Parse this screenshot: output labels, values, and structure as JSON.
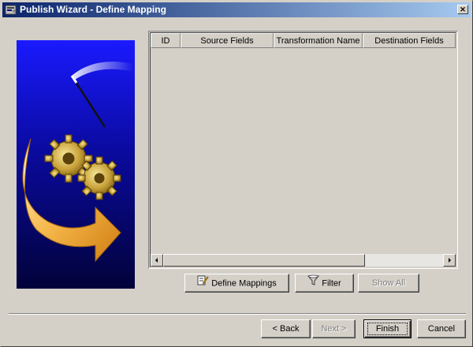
{
  "window": {
    "title": "Publish Wizard - Define Mapping",
    "close_glyph": "✕"
  },
  "table": {
    "columns": [
      "ID",
      "Source Fields",
      "Transformation Name",
      "Destination Fields"
    ],
    "rows": []
  },
  "mapping_buttons": {
    "define_mappings": "Define Mappings",
    "filter": "Filter",
    "show_all": "Show All"
  },
  "nav_buttons": {
    "back": "< Back",
    "next": "Next >",
    "finish": "Finish",
    "cancel": "Cancel"
  },
  "colors": {
    "titlebar_start": "#0a246a",
    "titlebar_end": "#a6caf0",
    "face": "#d4d0c8",
    "graphic_bg": "#0a0a6e"
  }
}
